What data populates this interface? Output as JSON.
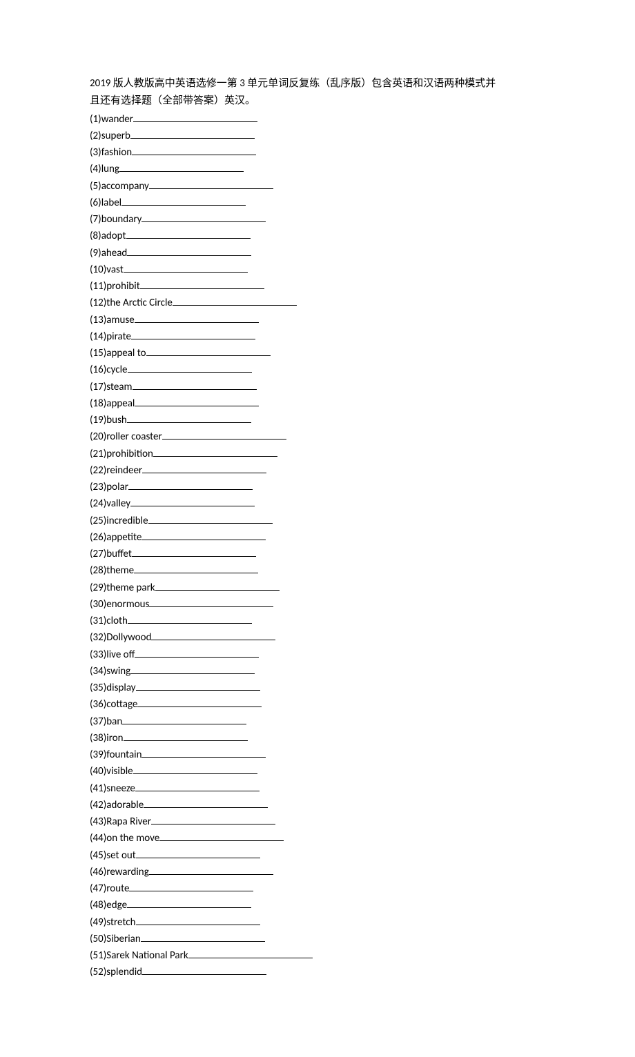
{
  "title_line1": "2019 版人教版高中英语选修一第 3 单元单词反复练（乱序版）包含英语和汉语两种模式并",
  "title_line2": "且还有选择题（全部带答案）英汉。",
  "items": [
    "(1)wander",
    "(2)superb",
    "(3)fashion",
    "(4)lung",
    "(5)accompany",
    "(6)label",
    "(7)boundary",
    "(8)adopt",
    "(9)ahead",
    "(10)vast",
    "(11)prohibit",
    "(12)the Arctic Circle",
    "(13)amuse",
    "(14)pirate",
    "(15)appeal to",
    "(16)cycle",
    "(17)steam",
    "(18)appeal",
    "(19)bush",
    "(20)roller coaster",
    "(21)prohibition",
    "(22)reindeer",
    "(23)polar",
    "(24)valley",
    "(25)incredible",
    "(26)appetite",
    "(27)buffet",
    "(28)theme",
    "(29)theme park",
    "(30)enormous",
    "(31)cloth",
    "(32)Dollywood",
    "(33)live off",
    "(34)swing",
    "(35)display",
    "(36)cottage",
    "(37)ban",
    "(38)iron",
    "(39)fountain",
    "(40)visible",
    "(41)sneeze",
    "(42)adorable",
    "(43)Rapa River",
    "(44)on the move",
    "(45)set out",
    "(46)rewarding",
    "(47)route",
    "(48)edge",
    "(49)stretch",
    "(50)Siberian",
    "(51)Sarek National Park",
    "(52)splendid"
  ]
}
